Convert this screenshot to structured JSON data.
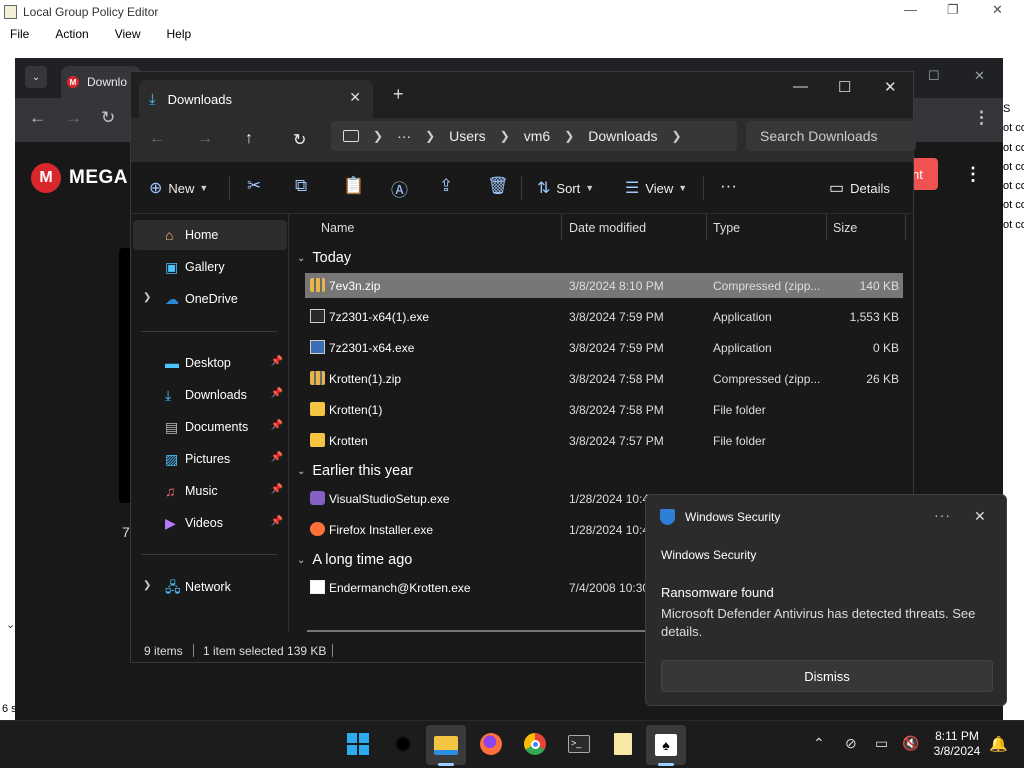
{
  "gpe": {
    "title": "Local Group Policy Editor",
    "menu": [
      "File",
      "Action",
      "View",
      "Help"
    ],
    "right_col_lines": [
      "S",
      "ot co",
      "ot co",
      "ot co",
      "ot co",
      "ot co",
      "ot co"
    ],
    "status": "6 s"
  },
  "chrome": {
    "tab_label": "Downlo",
    "mega_label": "MEGA",
    "partial_button": "nt",
    "left_char": "7"
  },
  "explorer": {
    "tab_title": "Downloads",
    "breadcrumb": [
      "Users",
      "vm6",
      "Downloads"
    ],
    "search_placeholder": "Search Downloads",
    "commands": {
      "new": "New",
      "sort": "Sort",
      "view": "View",
      "details": "Details"
    },
    "nav": {
      "home": "Home",
      "gallery": "Gallery",
      "onedrive": "OneDrive",
      "desktop": "Desktop",
      "downloads": "Downloads",
      "documents": "Documents",
      "pictures": "Pictures",
      "music": "Music",
      "videos": "Videos",
      "network": "Network"
    },
    "columns": {
      "name": "Name",
      "date": "Date modified",
      "type": "Type",
      "size": "Size"
    },
    "groups": {
      "today": "Today",
      "earlier": "Earlier this year",
      "longago": "A long time ago"
    },
    "files": [
      {
        "name": "7ev3n.zip",
        "date": "3/8/2024 8:10 PM",
        "type": "Compressed (zipp...",
        "size": "140 KB",
        "icon": "zip-icon"
      },
      {
        "name": "7z2301-x64(1).exe",
        "date": "3/8/2024 7:59 PM",
        "type": "Application",
        "size": "1,553 KB",
        "icon": "exe-icon"
      },
      {
        "name": "7z2301-x64.exe",
        "date": "3/8/2024 7:59 PM",
        "type": "Application",
        "size": "0 KB",
        "icon": "exe-icon"
      },
      {
        "name": "Krotten(1).zip",
        "date": "3/8/2024 7:58 PM",
        "type": "Compressed (zipp...",
        "size": "26 KB",
        "icon": "zip-icon"
      },
      {
        "name": "Krotten(1)",
        "date": "3/8/2024 7:58 PM",
        "type": "File folder",
        "size": "",
        "icon": "folder-icon"
      },
      {
        "name": "Krotten",
        "date": "3/8/2024 7:57 PM",
        "type": "File folder",
        "size": "",
        "icon": "folder-icon"
      },
      {
        "name": "VisualStudioSetup.exe",
        "date": "1/28/2024 10:4",
        "type": "",
        "size": "",
        "icon": "visual-studio-icon"
      },
      {
        "name": "Firefox Installer.exe",
        "date": "1/28/2024 10:4",
        "type": "",
        "size": "",
        "icon": "firefox-icon"
      },
      {
        "name": "Endermanch@Krotten.exe",
        "date": "7/4/2008 10:30",
        "type": "",
        "size": "",
        "icon": "file-icon"
      }
    ],
    "status": {
      "count": "9 items",
      "selection": "1 item selected  139 KB"
    }
  },
  "toast": {
    "app": "Windows Security",
    "subtitle": "Windows Security",
    "heading": "Ransomware found",
    "body": "Microsoft Defender Antivirus has detected threats. See details.",
    "dismiss": "Dismiss"
  },
  "taskbar": {
    "time": "8:11 PM",
    "date": "3/8/2024"
  }
}
